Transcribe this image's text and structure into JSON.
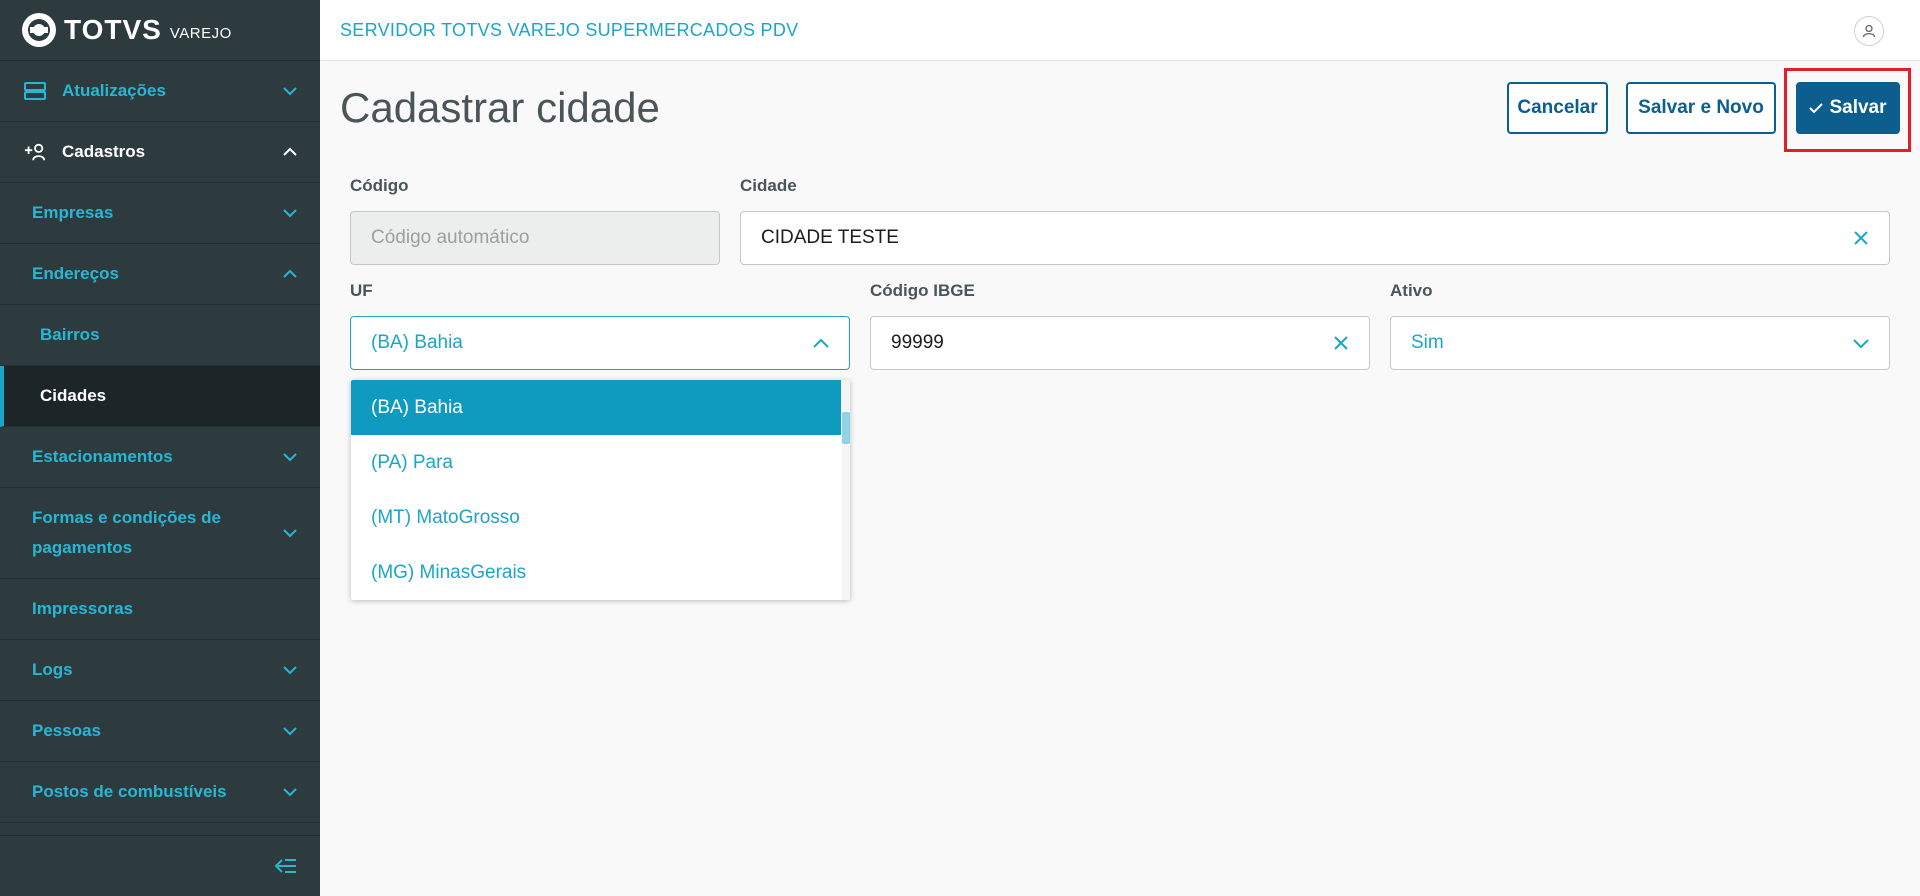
{
  "brand": {
    "name": "TOTVS",
    "sub": "VAREJO"
  },
  "sidebar": {
    "items": [
      {
        "label": "Atualizações"
      },
      {
        "label": "Cadastros"
      },
      {
        "label": "Empresas"
      },
      {
        "label": "Endereços"
      },
      {
        "label": "Bairros"
      },
      {
        "label": "Cidades"
      },
      {
        "label": "Estacionamentos"
      },
      {
        "label_line1": "Formas e condições de",
        "label_line2": "pagamentos"
      },
      {
        "label": "Impressoras"
      },
      {
        "label": "Logs"
      },
      {
        "label": "Pessoas"
      },
      {
        "label": "Postos de combustíveis"
      }
    ]
  },
  "header": {
    "app_title": "SERVIDOR TOTVS VAREJO SUPERMERCADOS PDV"
  },
  "page": {
    "title": "Cadastrar cidade",
    "buttons": {
      "cancel": "Cancelar",
      "save_new": "Salvar e Novo",
      "save": "Salvar"
    }
  },
  "form": {
    "codigo": {
      "label": "Código",
      "placeholder": "Código automático"
    },
    "cidade": {
      "label": "Cidade",
      "value": "CIDADE TESTE"
    },
    "uf": {
      "label": "UF",
      "value": "(BA) Bahia",
      "options": [
        "(BA) Bahia",
        "(PA) Para",
        "(MT) MatoGrosso",
        "(MG) MinasGerais"
      ]
    },
    "ibge": {
      "label": "Código IBGE",
      "value": "99999"
    },
    "ativo": {
      "label": "Ativo",
      "value": "Sim"
    }
  },
  "colors": {
    "accent": "#1ba6c7",
    "primary": "#0c5e8f",
    "sidebar_bg": "#2d3b3e",
    "highlight": "#e21f26"
  }
}
